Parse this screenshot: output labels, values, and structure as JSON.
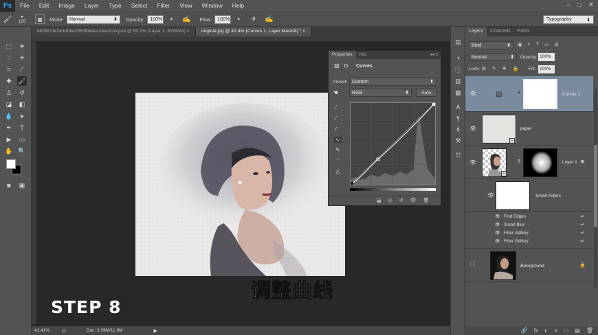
{
  "menubar": {
    "logo": "Ps",
    "items": [
      "File",
      "Edit",
      "Image",
      "Layer",
      "Type",
      "Select",
      "Filter",
      "View",
      "Window",
      "Help"
    ],
    "window_controls": [
      "–",
      "□",
      "✕"
    ]
  },
  "options_bar": {
    "brush_size": "125",
    "mode_label": "Mode:",
    "mode_value": "Normal",
    "opacity_label": "Opacity:",
    "opacity_value": "100%",
    "flow_label": "Flow:",
    "flow_value": "100%",
    "workspace": "Typography"
  },
  "tabs": [
    {
      "label": "bb2f87de2e39f9ec0f63fb64cc24ad31b.psd @ 50.1% (Layer 1, RGB/8#) ×",
      "active": false
    },
    {
      "label": "original.jpg @ 41.4% (Curves 1, Layer Mask/8) * ×",
      "active": true
    }
  ],
  "status": {
    "zoom": "41.41%",
    "doc": "Doc: 3.39M/11.9M"
  },
  "caption": "调整曲线",
  "step": "STEP 8",
  "properties": {
    "tabs": [
      "Properties",
      "Info"
    ],
    "title": "Curves",
    "preset_label": "Preset:",
    "preset_value": "Custom",
    "channel": "RGB",
    "auto_label": "Auto"
  },
  "layers_panel": {
    "tabs": [
      "Layers",
      "Channels",
      "Paths"
    ],
    "filter": "Kind",
    "blend_mode": "Normal",
    "opacity_label": "Opacity:",
    "opacity_value": "100%",
    "lock_label": "Lock:",
    "fill_label": "Fill:",
    "fill_value": "100%",
    "layers": {
      "curves": "Curves 1",
      "paper": "paper",
      "layer1": "Layer 1",
      "smart_filters": "Smart Filters",
      "background": "Background"
    },
    "filters": [
      "Find Edges",
      "Smart Blur",
      "Filter Gallery",
      "Filter Gallery"
    ],
    "bottom_icons": [
      "🔗",
      "fx",
      "◐",
      "◑",
      "▭",
      "▤",
      "🗑"
    ]
  },
  "colors": {
    "accent": "#31a8ff",
    "selected_layer": "#7a8ba0",
    "panel_bg": "#535353"
  }
}
